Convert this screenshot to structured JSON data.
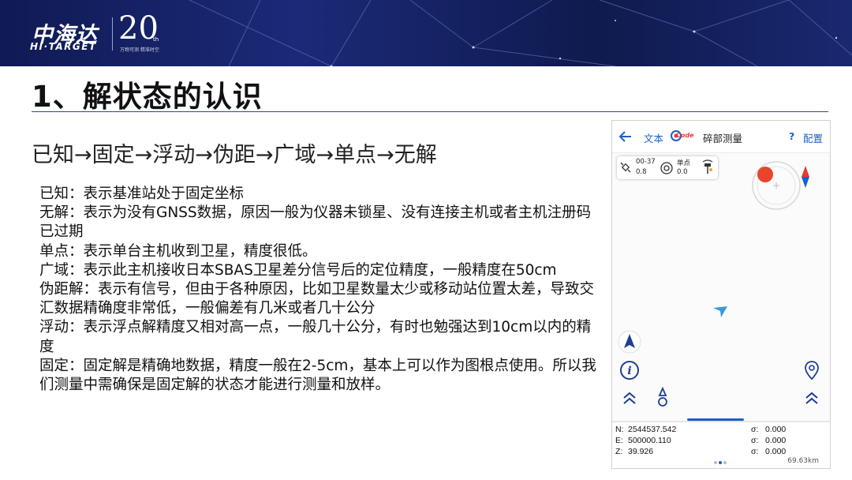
{
  "brand": {
    "name_cn": "中海达",
    "name_en": "HI·TARGET",
    "anniversary": "20",
    "anniversary_suffix": "th",
    "slogan": "万物可测 精准时空"
  },
  "slide": {
    "title": "1、解状态的认识",
    "subtitle": "已知→固定→浮动→伪距→广域→单点→无解",
    "paragraphs": [
      "已知：表示基准站处于固定坐标",
      "无解：表示为没有GNSS数据，原因一般为仪器未锁星、没有连接主机或者主机注册码已过期",
      "单点：表示单台主机收到卫星，精度很低。",
      "广域：表示此主机接收日本SBAS卫星差分信号后的定位精度，一般精度在50cm",
      "伪距解：表示有信号，但由于各种原因，比如卫星数量太少或移动站位置太差，导致交汇数据精确度非常低，一般偏差有几米或者几十公分",
      "浮动：表示浮点解精度又相对高一点，一般几十公分，有时也勉强达到10cm以内的精度",
      "固定：固定解是精确地数据，精度一般在2-5cm，基本上可以作为图根点使用。所以我们测量中需确保是固定解的状态才能进行测量和放样。"
    ]
  },
  "phone": {
    "toolbar": {
      "back_icon": "arrow-left-icon",
      "text_label": "文本",
      "code_label": "Code",
      "screen_title": "碎部测量",
      "help_label": "?",
      "config_label": "配置"
    },
    "status": {
      "satellite_value": "00-37",
      "satellite_sub": "0.8",
      "solution_label": "单点",
      "solution_sub": "0.0"
    },
    "coords": {
      "n_label": "N:",
      "n_value": "2544537.542",
      "e_label": "E:",
      "e_value": "500000.110",
      "z_label": "Z:",
      "z_value": "39.926",
      "sigma_label": "σ:",
      "sigma_n": "0.000",
      "sigma_e": "0.000",
      "sigma_z": "0.000"
    },
    "scale": "69.63km",
    "colors": {
      "accent": "#1d5fc9",
      "position_dot": "#e8452c",
      "compass_red": "#e53935",
      "compass_blue": "#1d5fc9"
    }
  }
}
